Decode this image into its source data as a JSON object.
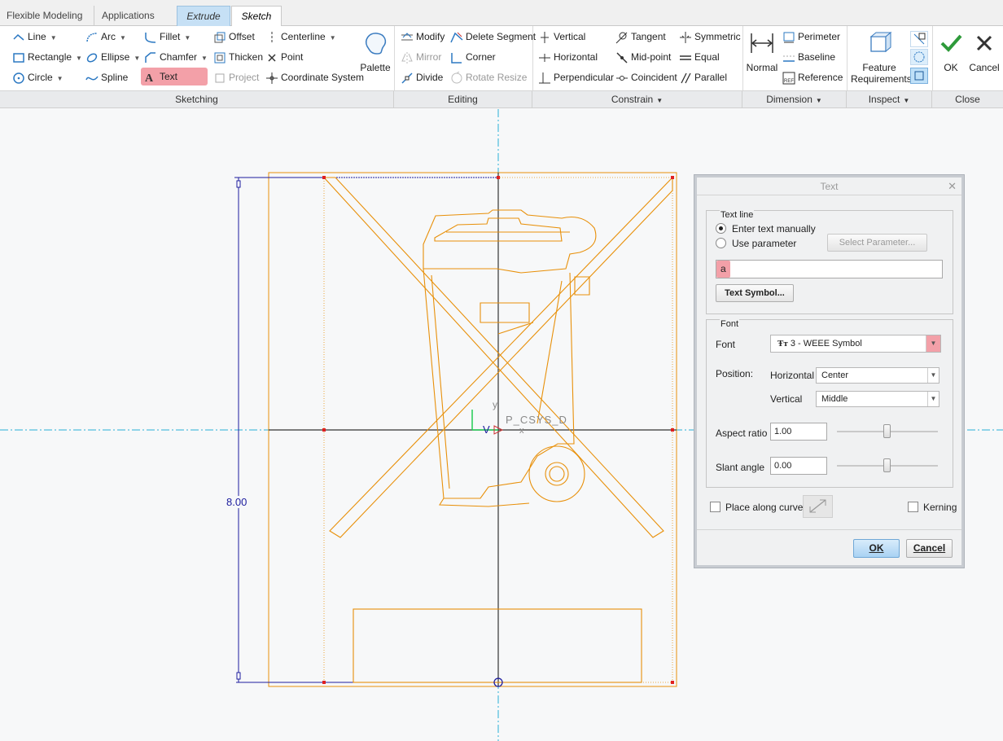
{
  "tabs": {
    "flexible_modeling": "Flexible Modeling",
    "applications": "Applications",
    "extrude": "Extrude",
    "sketch": "Sketch"
  },
  "ribbon": {
    "sketching": {
      "line": "Line",
      "arc": "Arc",
      "fillet": "Fillet",
      "offset": "Offset",
      "centerline": "Centerline",
      "rectangle": "Rectangle",
      "ellipse": "Ellipse",
      "chamfer": "Chamfer",
      "thicken": "Thicken",
      "point": "Point",
      "circle": "Circle",
      "spline": "Spline",
      "text": "Text",
      "project": "Project",
      "coordinate_system": "Coordinate System",
      "palette": "Palette"
    },
    "editing": {
      "modify": "Modify",
      "delete_segment": "Delete Segment",
      "mirror": "Mirror",
      "corner": "Corner",
      "divide": "Divide",
      "rotate_resize": "Rotate Resize"
    },
    "constrain": {
      "vertical": "Vertical",
      "tangent": "Tangent",
      "symmetric": "Symmetric",
      "horizontal": "Horizontal",
      "midpoint": "Mid-point",
      "equal": "Equal",
      "perpendicular": "Perpendicular",
      "coincident": "Coincident",
      "parallel": "Parallel"
    },
    "dimension": {
      "normal": "Normal",
      "perimeter": "Perimeter",
      "baseline": "Baseline",
      "reference": "Reference"
    },
    "inspect": {
      "feature_requirements_1": "Feature",
      "feature_requirements_2": "Requirements"
    },
    "close": {
      "ok": "OK",
      "cancel": "Cancel"
    }
  },
  "groups": {
    "sketching": "Sketching",
    "editing": "Editing",
    "constrain": "Constrain",
    "dimension": "Dimension",
    "inspect": "Inspect",
    "close": "Close"
  },
  "canvas": {
    "dimension_value": "8.00",
    "csys_label": "P_CSYS_D",
    "axis_y": "y",
    "axis_v": "V",
    "axis_x": "x"
  },
  "dialog": {
    "title": "Text",
    "text_line": {
      "legend": "Text line",
      "enter_manually": "Enter text manually",
      "use_parameter": "Use parameter",
      "select_parameter": "Select Parameter...",
      "text_value": "a",
      "text_symbol": "Text Symbol..."
    },
    "font": {
      "legend": "Font",
      "font_label": "Font",
      "font_value": "3 - WEEE Symbol",
      "position_label": "Position:",
      "horizontal_label": "Horizontal",
      "horizontal_value": "Center",
      "vertical_label": "Vertical",
      "vertical_value": "Middle",
      "aspect_label": "Aspect ratio",
      "aspect_value": "1.00",
      "slant_label": "Slant angle",
      "slant_value": "0.00"
    },
    "place_along_curve": "Place along curve",
    "kerning": "Kerning",
    "ok": "OK",
    "cancel": "Cancel"
  },
  "colors": {
    "sketch": "#e8900a",
    "dimension": "#1c1c9e",
    "accent_highlight": "#f3a0a8",
    "axis": "#2ab0d8"
  }
}
